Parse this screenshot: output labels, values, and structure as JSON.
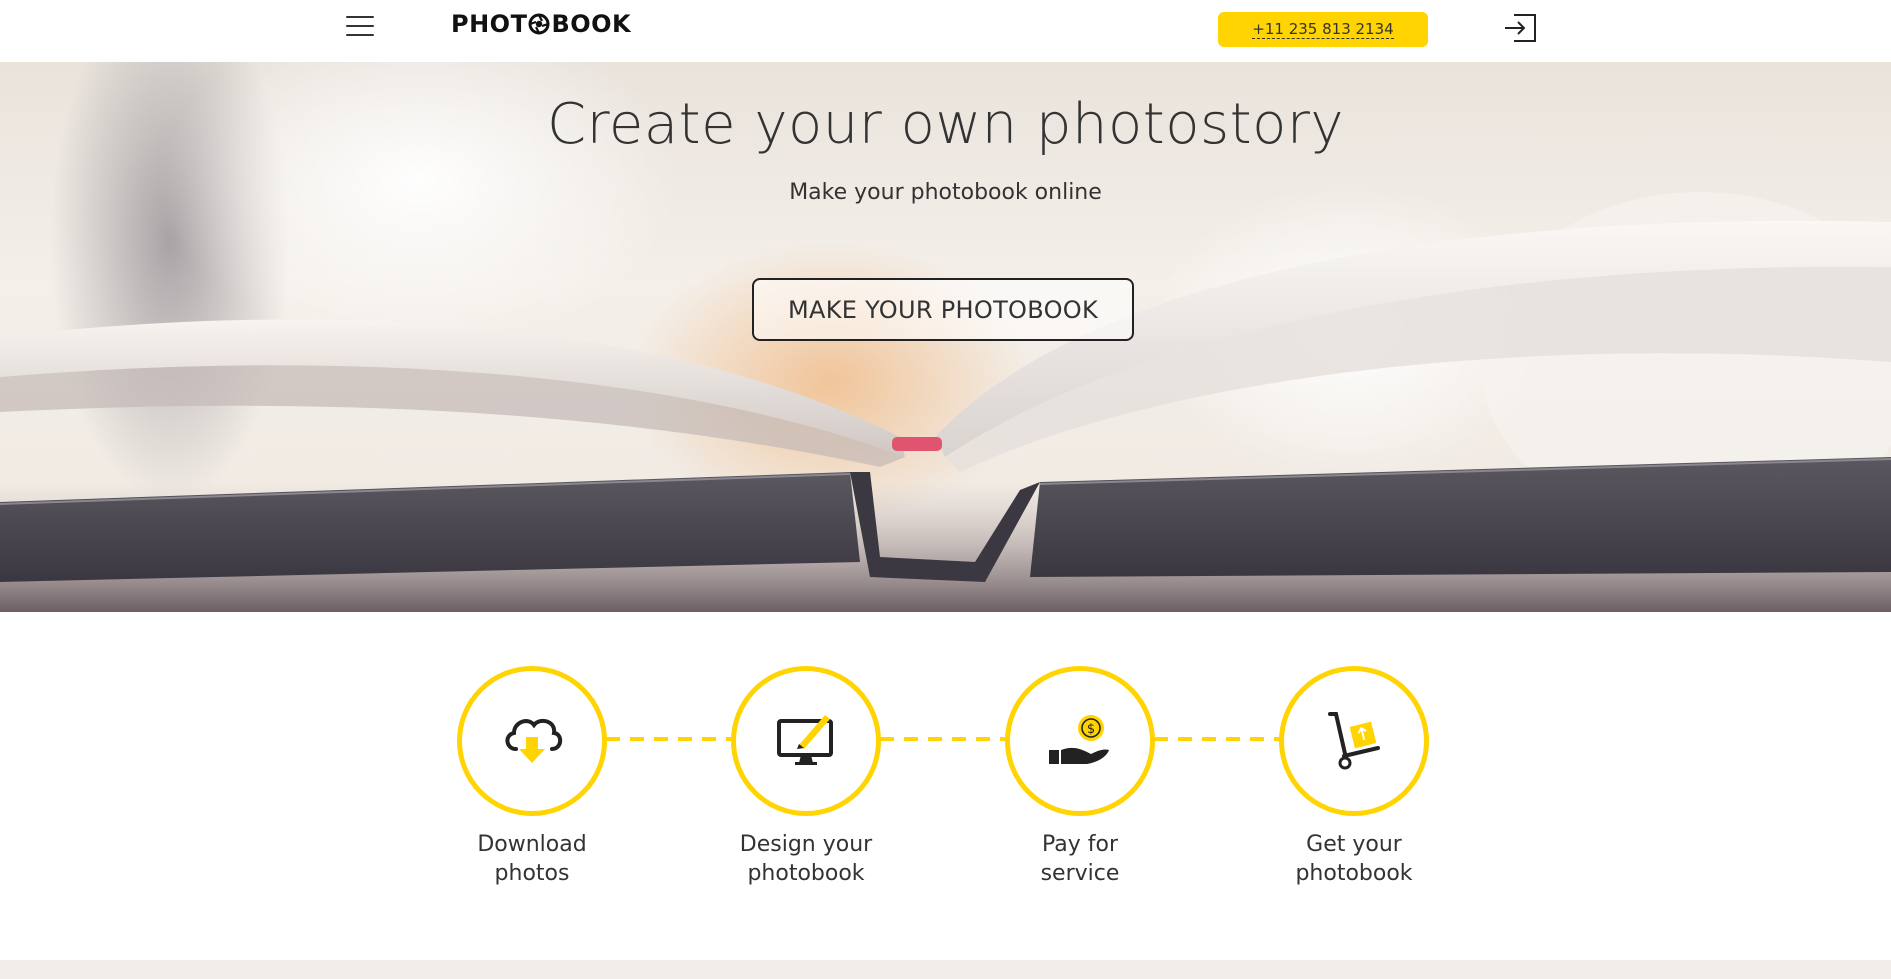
{
  "header": {
    "menu_icon": "hamburger-menu-icon",
    "logo_text_left": "PHOT",
    "logo_text_right": "BOOK",
    "logo_icon": "aperture-icon",
    "phone": "+11 235 813 2134",
    "login_icon": "sign-in-icon",
    "accent_color": "#ffd400"
  },
  "hero": {
    "title": "Create your own photostory",
    "subtitle": "Make your photobook online",
    "cta_label": "MAKE YOUR PHOTOBOOK"
  },
  "steps": [
    {
      "label_line1": "Download",
      "label_line2": "photos",
      "icon": "cloud-download-icon"
    },
    {
      "label_line1": "Design your",
      "label_line2": "photobook",
      "icon": "monitor-design-icon"
    },
    {
      "label_line1": "Pay for",
      "label_line2": "service",
      "icon": "hand-coin-payment-icon"
    },
    {
      "label_line1": "Get your",
      "label_line2": "photobook",
      "icon": "delivery-cart-icon"
    }
  ]
}
